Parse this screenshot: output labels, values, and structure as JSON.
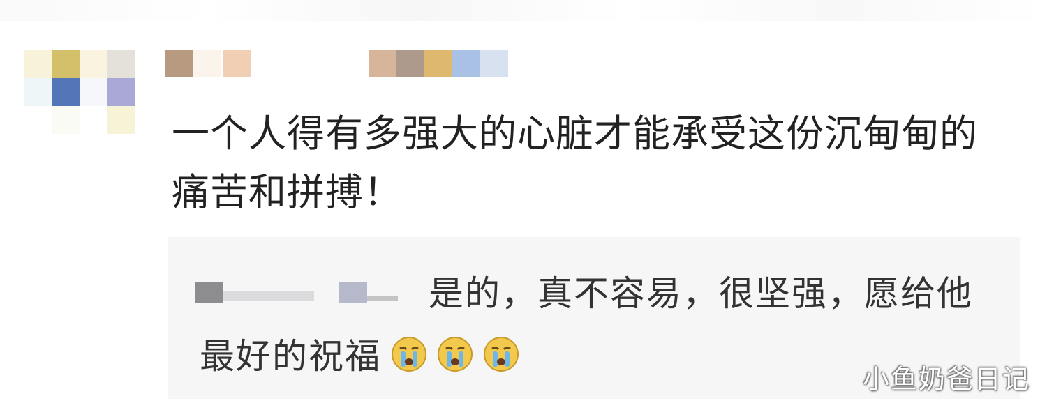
{
  "comment": {
    "text": "一个人得有多强大的心脏才能承受这份沉甸甸的痛苦和拼搏！"
  },
  "reply": {
    "text": "是的，真不容易，很坚强，愿给他最好的祝福"
  },
  "emojis": [
    "crying-face-icon",
    "crying-face-icon",
    "crying-face-icon"
  ],
  "watermark": {
    "text": "小鱼奶爸日记"
  },
  "colors": {
    "background": "#ffffff",
    "reply_background": "#f6f6f6",
    "comment_text": "#222222",
    "reply_text": "#333333",
    "emoji_face": "#f2c94c"
  }
}
